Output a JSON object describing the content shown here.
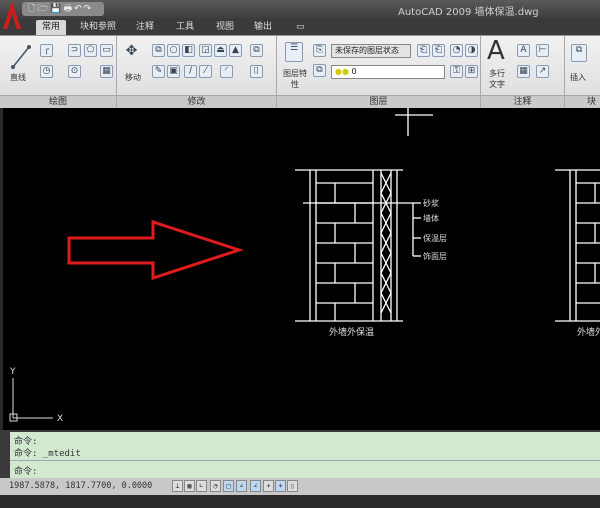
{
  "titlebar": {
    "title": "AutoCAD 2009 墙体保温.dwg",
    "qat": "🗋🗁💾🖶↶↷"
  },
  "tabs": [
    {
      "label": "常用"
    },
    {
      "label": "块和参照"
    },
    {
      "label": "注释"
    },
    {
      "label": "工具"
    },
    {
      "label": "视图"
    },
    {
      "label": "输出"
    },
    {
      "label": "▭"
    }
  ],
  "ribbon": {
    "panels": [
      {
        "label": "绘图"
      },
      {
        "label": "修改"
      },
      {
        "label": "图层"
      },
      {
        "label": "注释"
      },
      {
        "label": "块"
      }
    ],
    "draw": {
      "line_label": "直线"
    },
    "modify": {
      "move_label": "移动"
    },
    "layers": {
      "props_label": "图层特性",
      "state_value": "未保存的图层状态",
      "layer_value": "0"
    },
    "annotation": {
      "mtext_label": "多行文字"
    },
    "block": {
      "insert_label": "插入"
    }
  },
  "drawing": {
    "arrow_color": "#e01b1b",
    "callouts": [
      "砂浆",
      "墙体",
      "保温层",
      "饰面层"
    ],
    "caption": "外墙外保温",
    "caption2": "外墙外",
    "ucs_x": "X",
    "ucs_y": "Y"
  },
  "command": {
    "lines": [
      "命令:",
      "命令: _mtedit",
      "命令:"
    ]
  },
  "status": {
    "coords": "1987.5878, 1817.7700, 0.0000"
  }
}
